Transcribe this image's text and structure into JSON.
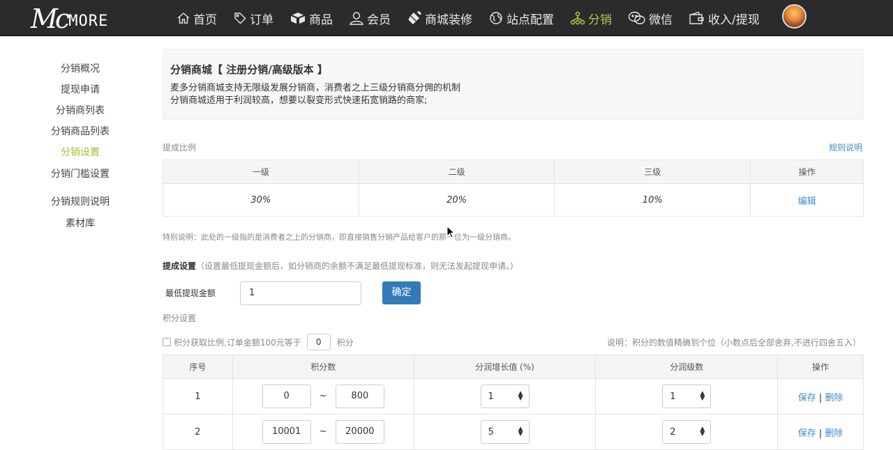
{
  "brand": {
    "logo_big": "Mc",
    "logo_rest": "MORE"
  },
  "nav": [
    {
      "label": "首页",
      "icon": "home-icon"
    },
    {
      "label": "订单",
      "icon": "tag-icon"
    },
    {
      "label": "商品",
      "icon": "boxes-icon"
    },
    {
      "label": "会员",
      "icon": "user-icon"
    },
    {
      "label": "商城装修",
      "icon": "brush-icon"
    },
    {
      "label": "站点配置",
      "icon": "globe-icon"
    },
    {
      "label": "分销",
      "icon": "sitemap-icon",
      "active": true
    },
    {
      "label": "微信",
      "icon": "wechat-icon"
    },
    {
      "label": "收入/提现",
      "icon": "wallet-icon"
    }
  ],
  "sidebar": {
    "items": [
      {
        "label": "分销概况"
      },
      {
        "label": "提现申请"
      },
      {
        "label": "分销商列表"
      },
      {
        "label": "分销商品列表"
      },
      {
        "label": "分销设置",
        "active": true
      },
      {
        "label": "分销门槛设置"
      },
      {
        "label": "分销规则说明"
      },
      {
        "label": "素材库"
      }
    ]
  },
  "intro": {
    "title": "分销商城【 注册分销/高级版本 】",
    "line1": "麦多分销商城支持无限级发展分销商，消费者之上三级分销商分佣的机制",
    "line2": "分销商城适用于利润较高，想要以裂变形式快速拓宽销路的商家;"
  },
  "commission": {
    "label": "提成比例",
    "rules_link": "规则说明",
    "headers": [
      "一级",
      "二级",
      "三级",
      "操作"
    ],
    "values": [
      "30%",
      "20%",
      "10%"
    ],
    "edit": "编辑",
    "note": "特别说明：此处的一级指的是消费者之上的分销商，即直接销售分销产品给客户的那一位为一级分销商。"
  },
  "withdraw": {
    "title": "提成设置",
    "desc": "（设置最低提现金额后，如分销商的余额不满足最低提现标准，则无法发起提现申请。）",
    "min_label": "最低提现金额",
    "min_value": "1",
    "confirm": "确定"
  },
  "points": {
    "title": "积分设置",
    "checkbox_label": "积分获取比例,订单金额100元等于",
    "ratio_value": "0",
    "unit": "积分",
    "explain": "说明：积分的数值精确到个位（小数点后全部舍弃,不进行四舍五入）",
    "headers": [
      "序号",
      "积分数",
      "分润增长值 (%)",
      "分润级数",
      "操作"
    ],
    "tilde": "~",
    "save": "保存",
    "sep": "|",
    "delete": "删除",
    "rows": [
      {
        "idx": "1",
        "from": "0",
        "to": "800",
        "growth": "1",
        "level": "1"
      },
      {
        "idx": "2",
        "from": "10001",
        "to": "20000",
        "growth": "5",
        "level": "2"
      }
    ]
  }
}
